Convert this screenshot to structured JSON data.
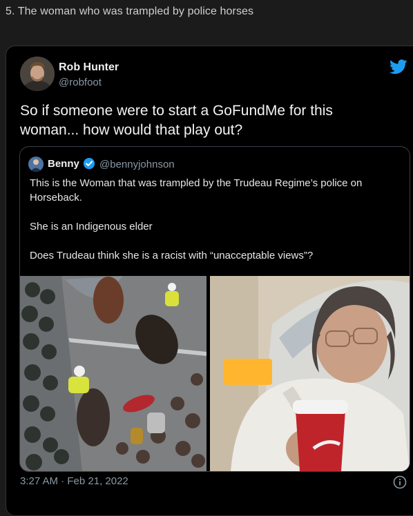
{
  "heading": "5. The woman who was trampled by police horses",
  "tweet": {
    "author_name": "Rob Hunter",
    "author_handle": "@robfoot",
    "text": "So if someone were to start a GoFundMe for this woman... how would that play out?",
    "timestamp": "3:27 AM · Feb 21, 2022"
  },
  "quoted": {
    "author_name": "Benny",
    "author_handle": "@bennyjohnson",
    "paragraphs": [
      "This is the Woman that was trampled by the Trudeau Regime’s police on Horseback.",
      "She is an Indigenous elder",
      "Does Trudeau think she is a racist with “unacceptable views”?"
    ]
  },
  "icons": {
    "brand": "twitter-bird-icon",
    "verified": "verified-badge-icon",
    "info": "info-icon"
  },
  "colors": {
    "twitter_blue": "#1d9bf0",
    "secondary_text": "#8b98a5"
  }
}
